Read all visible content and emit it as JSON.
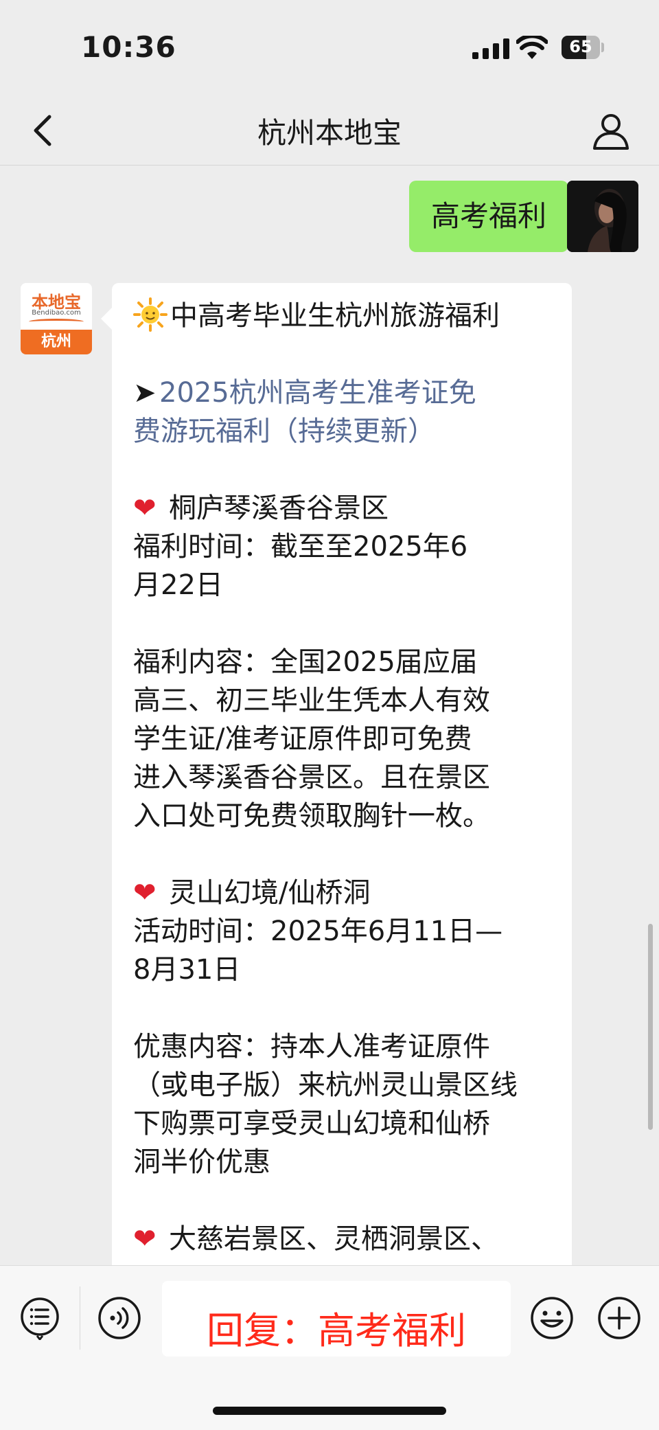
{
  "status_bar": {
    "time": "10:36",
    "battery": "65"
  },
  "nav": {
    "title": "杭州本地宝"
  },
  "my_message": {
    "text": "高考福利"
  },
  "bot": {
    "avatar_brand": "本地宝",
    "avatar_domain": "Bendibao.com",
    "avatar_city": "杭州",
    "lines": {
      "l1": "中高考毕业生杭州旅游福利",
      "l2_link": "2025杭州高考生准考证免",
      "l3_link": "费游玩福利（持续更新）",
      "l4": "桐庐琴溪香谷景区",
      "l5": "福利时间：截至至2025年6",
      "l6": "月22日",
      "l7": "福利内容：全国2025届应届",
      "l8": "高三、初三毕业生凭本人有效",
      "l9": "学生证/准考证原件即可免费",
      "l10": "进入琴溪香谷景区。且在景区",
      "l11": "入口处可免费领取胸针一枚。",
      "l12": "灵山幻境/仙桥洞",
      "l13": "活动时间：2025年6月11日—",
      "l14": "8月31日",
      "l15": "优惠内容：持本人准考证原件",
      "l16": "（或电子版）来杭州灵山景区线",
      "l17": "下购票可享受灵山幻境和仙桥",
      "l18": "洞半价优惠",
      "l19": "大慈岩景区、灵栖洞景区、"
    },
    "arrow_glyph": "➤",
    "heart_glyph": "❤"
  },
  "input_bar": {
    "reply_text": "回复：高考福利"
  },
  "colors": {
    "accent_green": "#95ec69",
    "link": "#576b95",
    "reply_red": "#ff2a1a"
  }
}
